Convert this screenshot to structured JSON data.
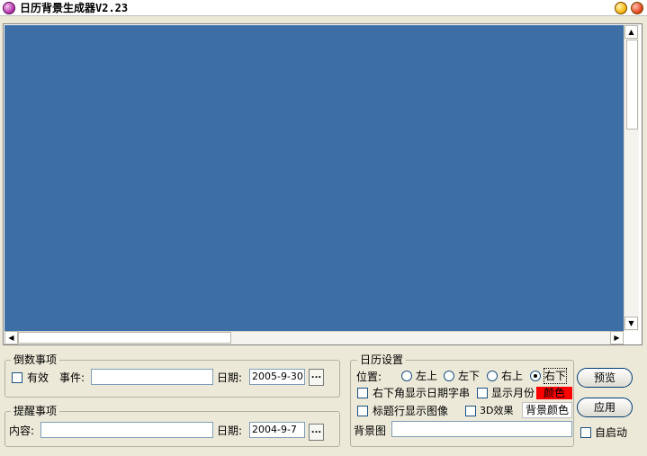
{
  "window": {
    "title": "日历背景生成器V2.23"
  },
  "countdown": {
    "legend": "倒数事项",
    "enabled_label": "有效",
    "event_label": "事件:",
    "event_value": "",
    "date_label": "日期:",
    "date_value": "2005-9-30",
    "browse_label": "..."
  },
  "reminder": {
    "legend": "提醒事项",
    "content_label": "内容:",
    "content_value": "",
    "date_label": "日期:",
    "date_value": "2004-9-7",
    "browse_label": "..."
  },
  "calendar_settings": {
    "legend": "日历设置",
    "position_label": "位置:",
    "positions": [
      "左上",
      "左下",
      "右上",
      "右下"
    ],
    "selected_position": "右下",
    "show_date_string_label": "右下角显示日期字串",
    "show_month_label": "显示月份",
    "color_label": "颜色",
    "color_value": "#ff0000",
    "title_image_label": "标题行显示图像",
    "effect_3d_label": "3D效果",
    "bg_color_label": "背景颜色",
    "bg_image_label": "背景图",
    "bg_image_value": ""
  },
  "actions": {
    "preview_label": "预览",
    "apply_label": "应用",
    "autostart_label": "自启动"
  },
  "colors": {
    "canvas": "#3d6fa6",
    "face": "#ece9d8"
  }
}
